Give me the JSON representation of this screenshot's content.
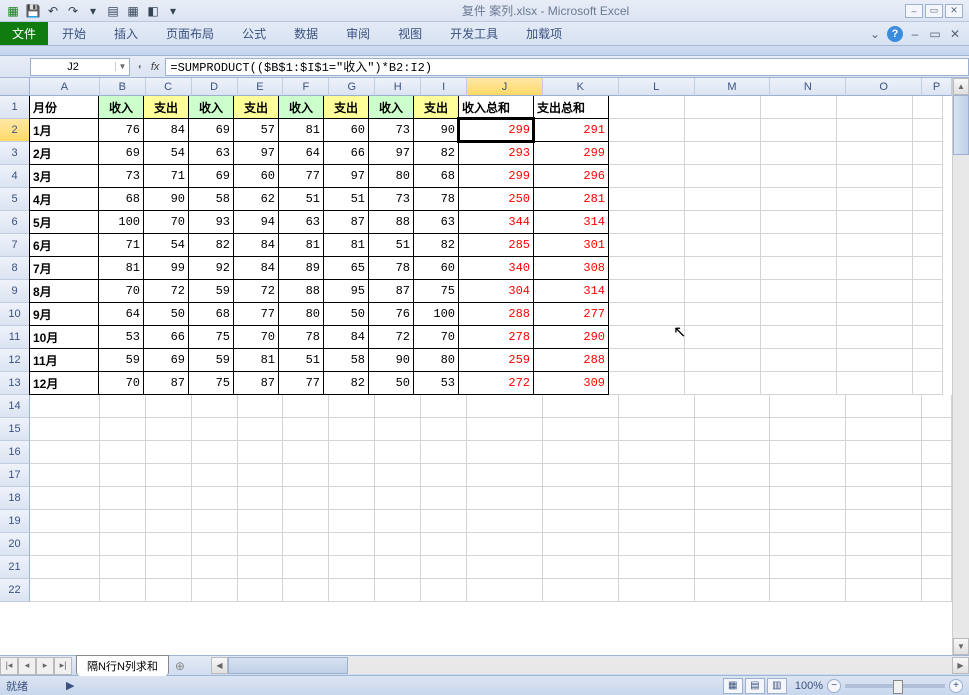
{
  "app": {
    "title": "复件 案列.xlsx - Microsoft Excel"
  },
  "ribbon": {
    "file": "文件",
    "tabs": [
      "开始",
      "插入",
      "页面布局",
      "公式",
      "数据",
      "审阅",
      "视图",
      "开发工具",
      "加载项"
    ]
  },
  "namebox": "J2",
  "formula": "=SUMPRODUCT(($B$1:$I$1=\"收入\")*B2:I2)",
  "columns": [
    "A",
    "B",
    "C",
    "D",
    "E",
    "F",
    "G",
    "H",
    "I",
    "J",
    "K",
    "L",
    "M",
    "N",
    "O",
    "P"
  ],
  "sel_col": "J",
  "sel_row": 2,
  "header_row": [
    "月份",
    "收入",
    "支出",
    "收入",
    "支出",
    "收入",
    "支出",
    "收入",
    "支出",
    "收入总和",
    "支出总和"
  ],
  "rows": [
    {
      "m": "1月",
      "v": [
        76,
        84,
        69,
        57,
        81,
        60,
        73,
        90
      ],
      "t": [
        299,
        291
      ]
    },
    {
      "m": "2月",
      "v": [
        69,
        54,
        63,
        97,
        64,
        66,
        97,
        82
      ],
      "t": [
        293,
        299
      ]
    },
    {
      "m": "3月",
      "v": [
        73,
        71,
        69,
        60,
        77,
        97,
        80,
        68
      ],
      "t": [
        299,
        296
      ]
    },
    {
      "m": "4月",
      "v": [
        68,
        90,
        58,
        62,
        51,
        51,
        73,
        78
      ],
      "t": [
        250,
        281
      ]
    },
    {
      "m": "5月",
      "v": [
        100,
        70,
        93,
        94,
        63,
        87,
        88,
        63
      ],
      "t": [
        344,
        314
      ]
    },
    {
      "m": "6月",
      "v": [
        71,
        54,
        82,
        84,
        81,
        81,
        51,
        82
      ],
      "t": [
        285,
        301
      ]
    },
    {
      "m": "7月",
      "v": [
        81,
        99,
        92,
        84,
        89,
        65,
        78,
        60
      ],
      "t": [
        340,
        308
      ]
    },
    {
      "m": "8月",
      "v": [
        70,
        72,
        59,
        72,
        88,
        95,
        87,
        75
      ],
      "t": [
        304,
        314
      ]
    },
    {
      "m": "9月",
      "v": [
        64,
        50,
        68,
        77,
        80,
        50,
        76,
        100
      ],
      "t": [
        288,
        277
      ]
    },
    {
      "m": "10月",
      "v": [
        53,
        66,
        75,
        70,
        78,
        84,
        72,
        70
      ],
      "t": [
        278,
        290
      ]
    },
    {
      "m": "11月",
      "v": [
        59,
        69,
        59,
        81,
        51,
        58,
        90,
        80
      ],
      "t": [
        259,
        288
      ]
    },
    {
      "m": "12月",
      "v": [
        70,
        87,
        75,
        87,
        77,
        82,
        50,
        53
      ],
      "t": [
        272,
        309
      ]
    }
  ],
  "sheet_tab": "隔N行N列求和",
  "status": {
    "ready": "就绪",
    "zoom": "100%"
  }
}
